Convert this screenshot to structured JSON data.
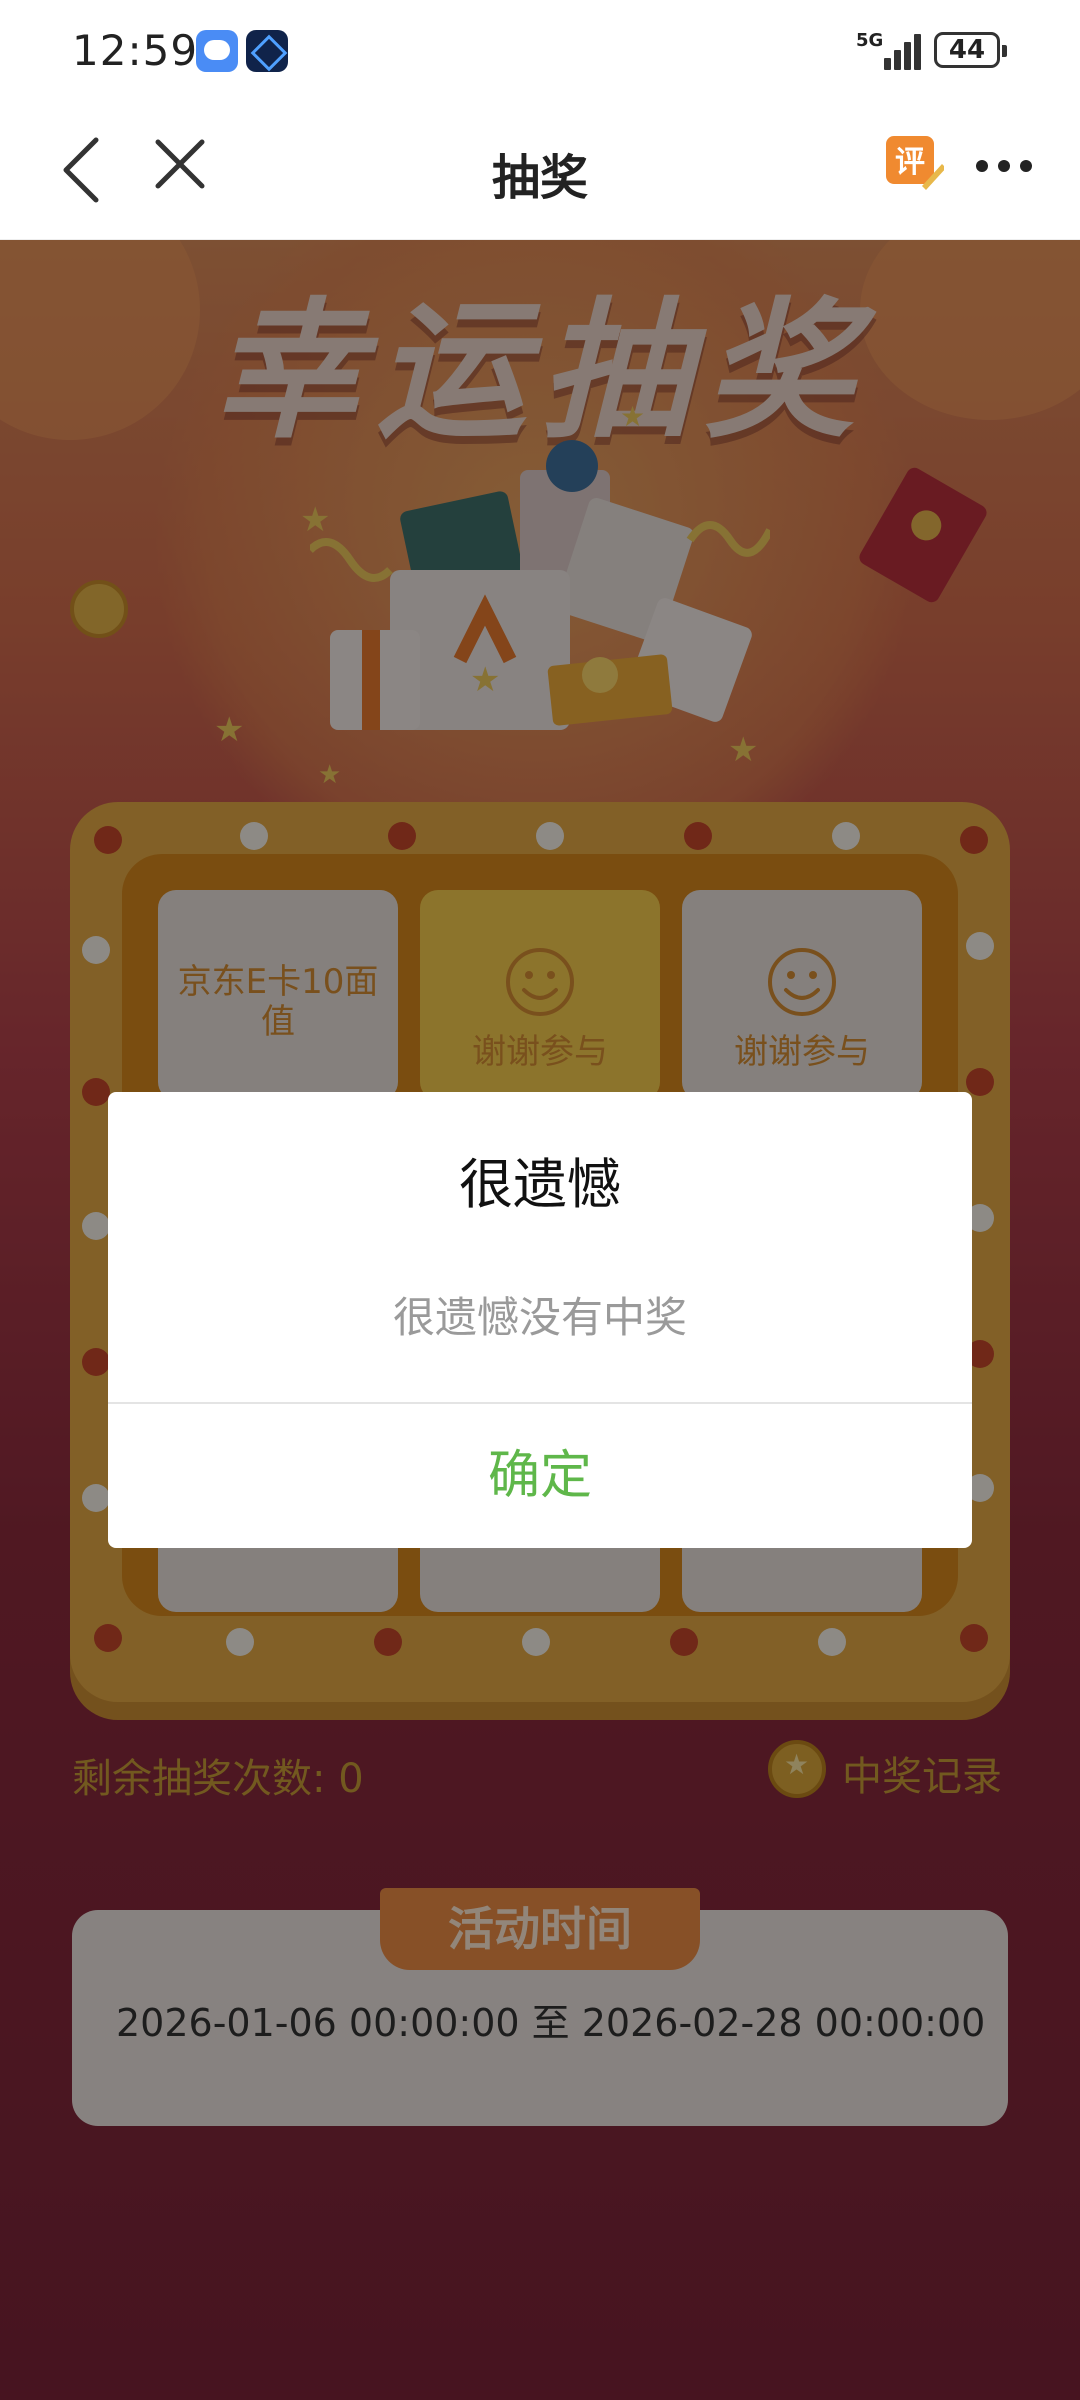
{
  "status_bar": {
    "time": "12:59",
    "network": "5G",
    "battery": "44",
    "notification_icons": [
      "message-app-icon",
      "cube-app-icon"
    ]
  },
  "nav": {
    "title": "抽奖",
    "back_icon": "back-icon",
    "close_icon": "close-icon",
    "review_icon_label": "评",
    "more_icon": "more-icon"
  },
  "banner": {
    "title": "幸运抽奖"
  },
  "lottery_grid": {
    "cells": [
      {
        "label": "京东E卡10面值",
        "type": "prize"
      },
      {
        "label": "谢谢参与",
        "type": "none",
        "highlighted": true
      },
      {
        "label": "谢谢参与",
        "type": "none"
      }
    ]
  },
  "info": {
    "remaining_label": "剩余抽奖次数: 0",
    "record_label": "中奖记录"
  },
  "activity": {
    "tab_label": "活动时间",
    "period": "2026-01-06 00:00:00 至 2026-02-28 00:00:00"
  },
  "dialog": {
    "title": "很遗憾",
    "message": "很遗憾没有中奖",
    "confirm_label": "确定"
  },
  "colors": {
    "accent_green": "#5fb74a",
    "board_gold": "#e0a644",
    "highlight_yellow": "#f2c94c",
    "page_red": "#8a2a3c"
  }
}
